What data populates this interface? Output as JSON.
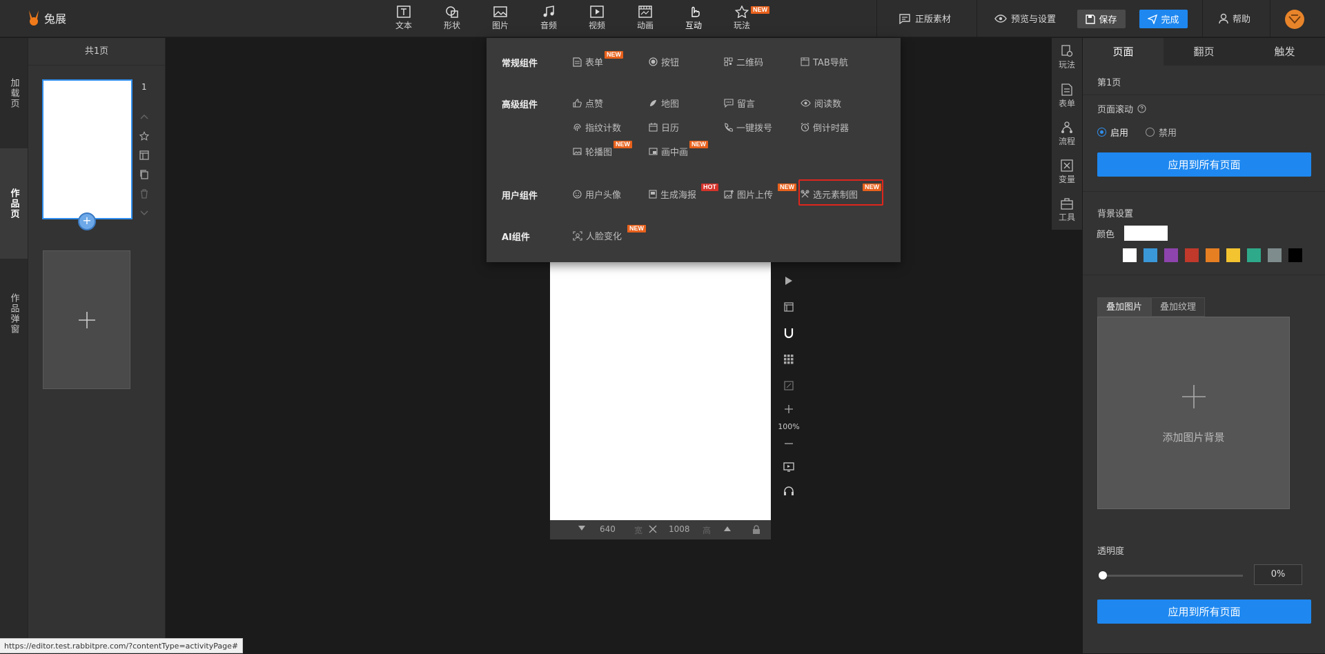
{
  "app": {
    "name": "兔展"
  },
  "toolbar": {
    "tools": [
      {
        "label": "文本",
        "icon": "text-icon"
      },
      {
        "label": "形状",
        "icon": "shape-icon"
      },
      {
        "label": "图片",
        "icon": "image-icon"
      },
      {
        "label": "音频",
        "icon": "music-icon"
      },
      {
        "label": "视频",
        "icon": "video-icon"
      },
      {
        "label": "动画",
        "icon": "animation-icon"
      },
      {
        "label": "互动",
        "icon": "hand-pointer-icon"
      },
      {
        "label": "玩法",
        "icon": "star-icon",
        "badge": "NEW"
      }
    ],
    "material": "正版素材",
    "preview": "预览与设置",
    "save": "保存",
    "done": "完成",
    "help": "帮助"
  },
  "left_tabs": [
    "加载页",
    "作品页",
    "作品弹窗"
  ],
  "page_list": {
    "header": "共1页",
    "page_number": "1"
  },
  "dropdown": {
    "sections": [
      {
        "title": "常规组件",
        "items": [
          {
            "label": "表单",
            "icon": "form-icon",
            "badge": "NEW"
          },
          {
            "label": "按钮",
            "icon": "radio-button-icon"
          },
          {
            "label": "二维码",
            "icon": "qrcode-icon"
          },
          {
            "label": "TAB导航",
            "icon": "tab-nav-icon"
          }
        ]
      },
      {
        "title": "高级组件",
        "items": [
          {
            "label": "点赞",
            "icon": "thumbs-up-icon"
          },
          {
            "label": "地图",
            "icon": "map-icon"
          },
          {
            "label": "留言",
            "icon": "comment-icon"
          },
          {
            "label": "阅读数",
            "icon": "eye-icon"
          },
          {
            "label": "指纹计数",
            "icon": "fingerprint-icon"
          },
          {
            "label": "日历",
            "icon": "calendar-icon"
          },
          {
            "label": "一键拨号",
            "icon": "phone-icon"
          },
          {
            "label": "倒计时器",
            "icon": "alarm-clock-icon"
          },
          {
            "label": "轮播图",
            "icon": "carousel-icon",
            "badge": "NEW"
          },
          {
            "label": "画中画",
            "icon": "picture-in-picture-icon",
            "badge": "NEW"
          }
        ]
      },
      {
        "title": "用户组件",
        "items": [
          {
            "label": "用户头像",
            "icon": "smile-icon"
          },
          {
            "label": "生成海报",
            "icon": "poster-icon",
            "badge": "HOT"
          },
          {
            "label": "图片上传",
            "icon": "image-upload-icon",
            "badge": "NEW"
          },
          {
            "label": "选元素制图",
            "icon": "element-pick-icon",
            "badge": "NEW"
          }
        ]
      },
      {
        "title": "AI组件",
        "items": [
          {
            "label": "人脸变化",
            "icon": "face-scan-icon",
            "badge": "NEW"
          }
        ]
      }
    ]
  },
  "canvas": {
    "width_value": "640",
    "width_unit": "宽",
    "height_value": "1008",
    "height_unit": "高",
    "zoom": "100%"
  },
  "icon_strip": [
    {
      "label": "玩法",
      "icon": "play-method-icon"
    },
    {
      "label": "表单",
      "icon": "form-icon"
    },
    {
      "label": "流程",
      "icon": "flow-icon"
    },
    {
      "label": "变量",
      "icon": "variable-icon"
    },
    {
      "label": "工具",
      "icon": "toolbox-icon"
    }
  ],
  "properties": {
    "tabs": [
      "页面",
      "翻页",
      "触发"
    ],
    "page_title": "第1页",
    "scroll_label": "页面滚动",
    "scroll_on": "启用",
    "scroll_off": "禁用",
    "apply_all": "应用到所有页面",
    "bg_title": "背景设置",
    "color_label": "颜色",
    "swatches": [
      "#ffffff",
      "#3a98d8",
      "#8e44ad",
      "#c0392b",
      "#e67e22",
      "#f4c430",
      "#2eaa8a",
      "#7f8c8d",
      "#000000"
    ],
    "overlay_tabs": [
      "叠加图片",
      "叠加纹理"
    ],
    "add_bg": "添加图片背景",
    "opacity_label": "透明度",
    "opacity_value": "0%",
    "apply_all_2": "应用到所有页面"
  },
  "status_url": "https://editor.test.rabbitpre.com/?contentType=activityPage#"
}
